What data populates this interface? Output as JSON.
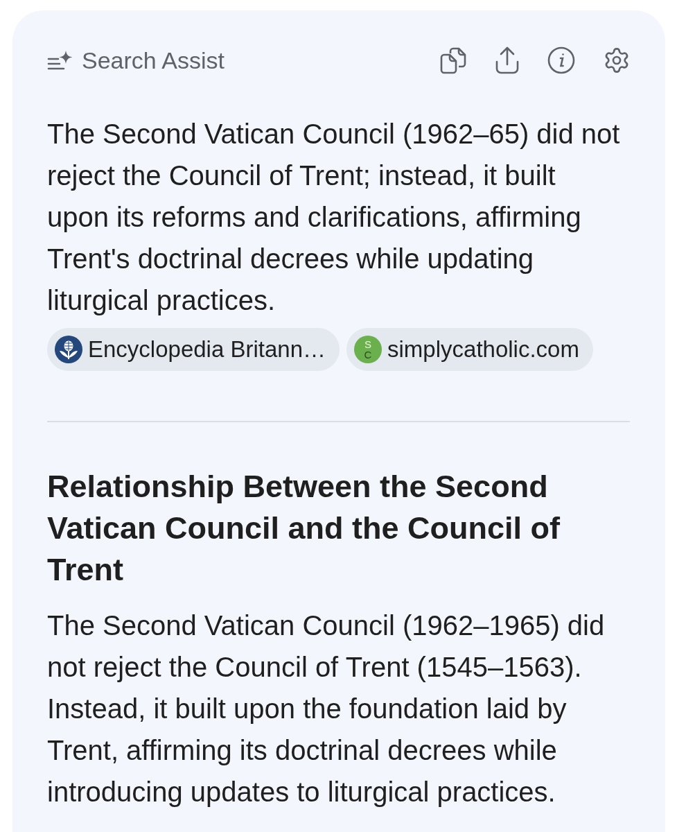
{
  "header": {
    "title": "Search Assist"
  },
  "answer": {
    "summary": "The Second Vatican Council (1962–65) did not reject the Council of Trent; instead, it built upon its reforms and clarifications, affirming Trent's doctrinal decrees while updating liturgical practices.",
    "sources": [
      {
        "kind": "logo",
        "label": "Encyclopedia Britann…"
      },
      {
        "kind": "letters",
        "letters": [
          "S",
          "C"
        ],
        "label": "simplycatholic.com"
      }
    ]
  },
  "section": {
    "heading": "Relationship Between the Second Vatican Council and the Council of Trent",
    "body": "The Second Vatican Council (1962–1965) did not reject the Council of Trent (1545–1563). Instead, it built upon the foundation laid by Trent, affirming its doctrinal decrees while introducing updates to liturgical practices."
  }
}
